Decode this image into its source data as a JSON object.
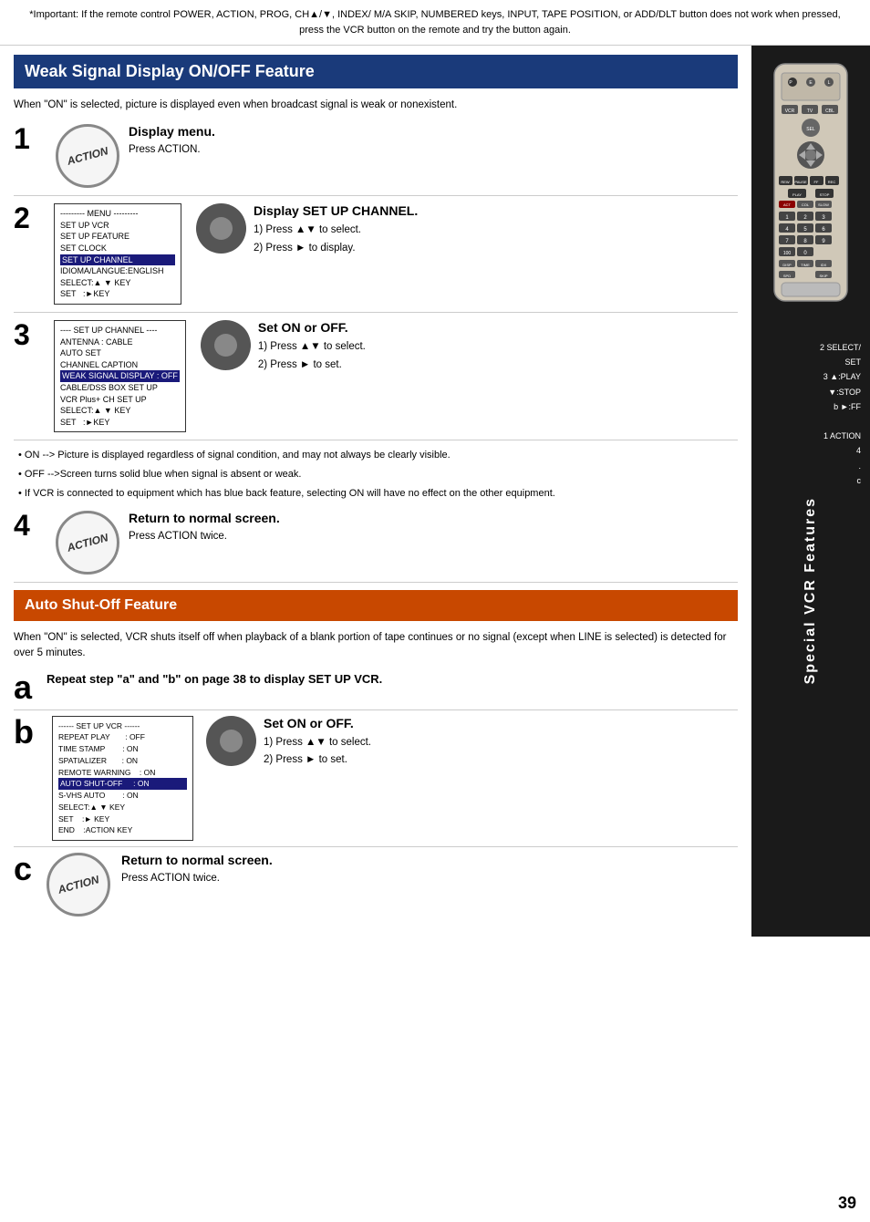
{
  "important": {
    "text": "*Important: If the remote control POWER, ACTION, PROG, CH▲/▼, INDEX/ M/A SKIP, NUMBERED keys, INPUT, TAPE POSITION, or ADD/DLT button does not work when pressed, press the VCR button on the remote and try the button again."
  },
  "section1": {
    "title": "Weak Signal Display ON/OFF Feature",
    "intro": "When \"ON\" is selected, picture is displayed even when broadcast signal is weak or nonexistent.",
    "steps": [
      {
        "number": "1",
        "action_label": "ACTION",
        "title": "Display menu.",
        "desc": "Press ACTION."
      },
      {
        "number": "2",
        "title": "Display SET UP CHANNEL.",
        "sub1": "1) Press ▲▼ to select.",
        "sub2": "2) Press ► to display."
      },
      {
        "number": "3",
        "title": "Set ON or OFF.",
        "sub1": "1) Press ▲▼ to select.",
        "sub2": "2) Press ► to set."
      },
      {
        "number": "4",
        "action_label": "ACTION",
        "title": "Return to normal screen.",
        "desc": "Press ACTION twice."
      }
    ],
    "menu2": {
      "lines": [
        "--------- MENU ---------",
        "SET UP VCR",
        "SET UP FEATURE",
        "SET CLOCK",
        "SET UP CHANNEL",
        "IDIOMA/LANGUE:ENGLISH",
        "SELECT:▲ ▼ KEY",
        "SET    :►KEY"
      ],
      "highlighted_line": "SET UP CHANNEL"
    },
    "menu3": {
      "lines": [
        "---- SET UP CHANNEL ----",
        "ANTENNA : CABLE",
        "AUTO SET",
        "CHANNEL CAPTION",
        "WEAK SIGNAL DISPLAY : OFF",
        "CABLE/DSS BOX SET UP",
        "VCR Plus+ CH SET UP",
        "SELECT:▲ ▼ KEY",
        "SET    :►KEY"
      ],
      "highlighted_line": "WEAK SIGNAL DISPLAY : OFF"
    },
    "notes": [
      "• ON --> Picture is displayed regardless of signal condition, and may not always be clearly visible.",
      "• OFF -->Screen turns solid blue when signal is absent or weak.",
      "• If VCR is connected to equipment which has blue back feature, selecting ON will have no effect on the other equipment."
    ]
  },
  "section2": {
    "title": "Auto Shut-Off Feature",
    "intro": "When \"ON\" is selected, VCR shuts itself off when playback of a blank portion of tape continues or no signal (except when LINE is selected) is detected for over 5 minutes.",
    "step_a": {
      "letter": "a",
      "title": "Repeat step \"a\" and \"b\" on page 38 to display SET UP VCR."
    },
    "step_b": {
      "letter": "b",
      "title": "Set ON or OFF.",
      "sub1": "1) Press ▲▼ to select.",
      "sub2": "2) Press ► to set.",
      "menu": {
        "lines": [
          "------ SET UP VCR ------",
          "REPEAT PLAY       : OFF",
          "TIME STAMP        : ON",
          "SPATIALIZER       : ON",
          "REMOTE WARNING    : ON",
          "AUTO SHUT-OFF     : ON",
          "S-VHS AUTO        : ON",
          "SELECT:▲ ▼ KEY",
          "SET    :► KEY",
          "END    :ACTION KEY"
        ],
        "highlighted_line": "AUTO SHUT-OFF     : ON"
      }
    },
    "step_c": {
      "letter": "c",
      "action_label": "ACTION",
      "title": "Return to normal screen.",
      "desc": "Press ACTION twice."
    }
  },
  "sidebar": {
    "title": "Special VCR Features",
    "legend": [
      "2 SELECT/",
      "  SET",
      "3 ▲:PLAY",
      "  ▼:STOP",
      "b ►:FF",
      "",
      "1 ACTION",
      "4",
      ".",
      "c"
    ]
  },
  "page_number": "39"
}
